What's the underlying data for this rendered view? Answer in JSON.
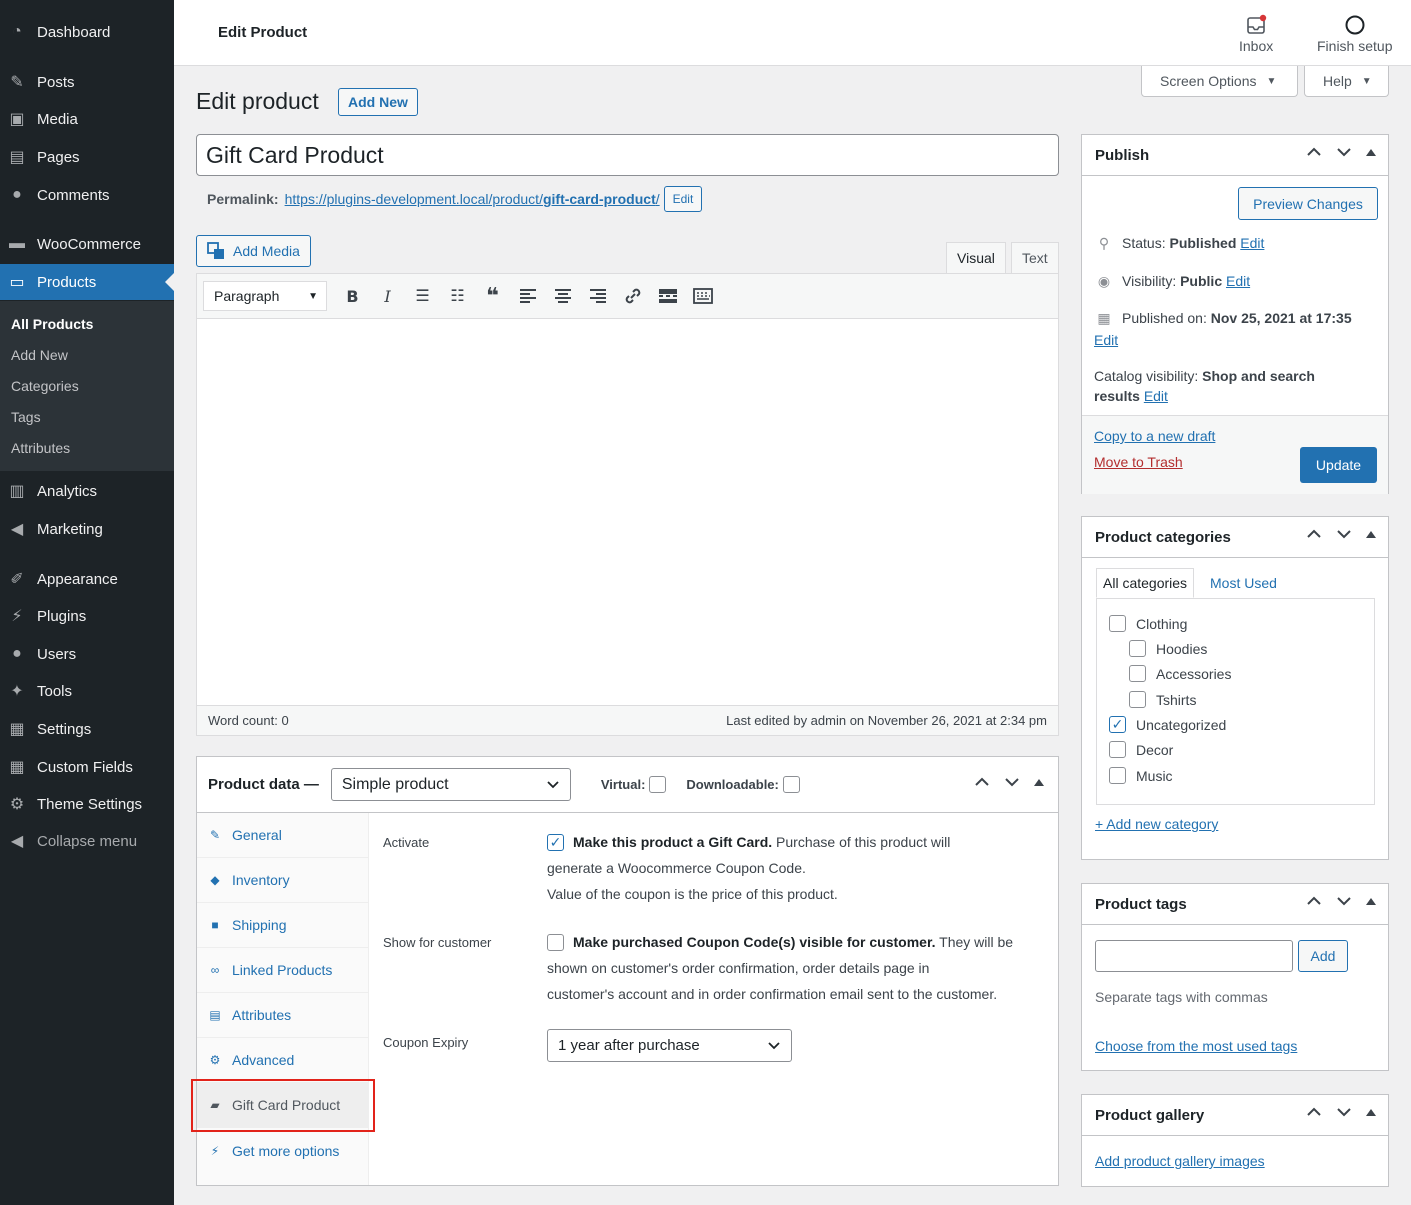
{
  "sidebar": {
    "items": [
      {
        "label": "Dashboard",
        "icon": "dashboard-icon"
      },
      {
        "label": "Posts",
        "icon": "pin-icon"
      },
      {
        "label": "Media",
        "icon": "media-icon"
      },
      {
        "label": "Pages",
        "icon": "pages-icon"
      },
      {
        "label": "Comments",
        "icon": "comments-icon"
      },
      {
        "label": "WooCommerce",
        "icon": "woo-icon"
      },
      {
        "label": "Products",
        "icon": "products-icon"
      },
      {
        "label": "Analytics",
        "icon": "analytics-icon"
      },
      {
        "label": "Marketing",
        "icon": "megaphone-icon"
      },
      {
        "label": "Appearance",
        "icon": "brush-icon"
      },
      {
        "label": "Plugins",
        "icon": "plugin-icon"
      },
      {
        "label": "Users",
        "icon": "user-icon"
      },
      {
        "label": "Tools",
        "icon": "wrench-icon"
      },
      {
        "label": "Settings",
        "icon": "settings-icon"
      },
      {
        "label": "Custom Fields",
        "icon": "table-icon"
      },
      {
        "label": "Theme Settings",
        "icon": "gear-icon"
      }
    ],
    "submenu": [
      "All Products",
      "Add New",
      "Categories",
      "Tags",
      "Attributes"
    ],
    "collapse_label": "Collapse menu"
  },
  "topbar": {
    "title": "Edit Product",
    "inbox_label": "Inbox",
    "finish_setup_label": "Finish setup"
  },
  "screen_options_label": "Screen Options",
  "help_label": "Help",
  "page": {
    "heading": "Edit product",
    "add_new_label": "Add New",
    "title_value": "Gift Card Product",
    "permalink_label": "Permalink:",
    "permalink_base": "https://plugins-development.local/product/",
    "permalink_slug": "gift-card-product",
    "permalink_trail": "/",
    "permalink_edit": "Edit"
  },
  "editor": {
    "add_media_label": "Add Media",
    "tab_visual": "Visual",
    "tab_text": "Text",
    "format_value": "Paragraph",
    "word_count": "Word count: 0",
    "last_edited": "Last edited by admin on November 26, 2021 at 2:34 pm"
  },
  "product_data": {
    "title": "Product data —",
    "type_value": "Simple product",
    "virtual_label": "Virtual:",
    "downloadable_label": "Downloadable:",
    "tabs": [
      "General",
      "Inventory",
      "Shipping",
      "Linked Products",
      "Attributes",
      "Advanced",
      "Gift Card Product",
      "Get more options"
    ],
    "activate_label": "Activate",
    "activate_bold": "Make this product a Gift Card.",
    "activate_line1_rest": " Purchase of this product will",
    "activate_line2": "generate a Woocommerce Coupon Code.",
    "activate_line3": "Value of the coupon is the price of this product.",
    "show_label": "Show for customer",
    "show_bold": "Make purchased Coupon Code(s) visible for customer.",
    "show_line1_rest": " They will be",
    "show_line2": "shown on customer's order confirmation, order details page in",
    "show_line3": "customer's account and in order confirmation email sent to the customer.",
    "expiry_label": "Coupon Expiry",
    "expiry_value": "1 year after purchase"
  },
  "publish": {
    "title": "Publish",
    "preview_label": "Preview Changes",
    "status_label": "Status:",
    "status_value": "Published",
    "visibility_label": "Visibility:",
    "visibility_value": "Public",
    "published_label": "Published on:",
    "published_value": "Nov 25, 2021 at 17:35",
    "catalog_label": "Catalog visibility:",
    "catalog_value_1": "Shop and search",
    "catalog_value_2": "results",
    "edit_label": "Edit",
    "copy_label": "Copy to a new draft",
    "trash_label": "Move to Trash",
    "update_label": "Update"
  },
  "categories": {
    "title": "Product categories",
    "tab_all": "All categories",
    "tab_most": "Most Used",
    "items": [
      {
        "label": "Clothing",
        "checked": false
      },
      {
        "label": "Hoodies",
        "checked": false
      },
      {
        "label": "Accessories",
        "checked": false
      },
      {
        "label": "Tshirts",
        "checked": false
      },
      {
        "label": "Uncategorized",
        "checked": true
      },
      {
        "label": "Decor",
        "checked": false
      },
      {
        "label": "Music",
        "checked": false
      }
    ],
    "add_new_label": "+ Add new category"
  },
  "tags": {
    "title": "Product tags",
    "input_value": "",
    "add_label": "Add",
    "hint": "Separate tags with commas",
    "choose_label": "Choose from the most used tags"
  },
  "gallery": {
    "title": "Product gallery",
    "add_label": "Add product gallery images"
  },
  "colors": {
    "sidebar_bg": "#1d2327",
    "accent": "#2271b1",
    "highlight": "#e2231a",
    "trash": "#b32d2e"
  }
}
